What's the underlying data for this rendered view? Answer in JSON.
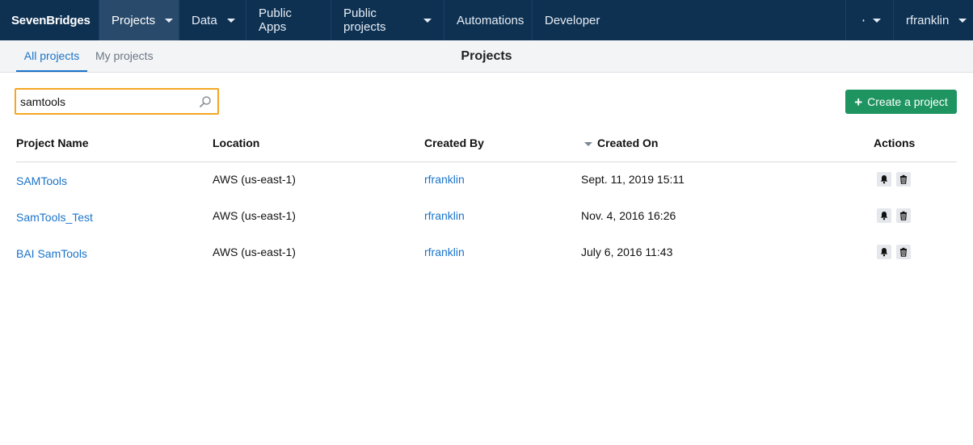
{
  "brand": "SevenBridges",
  "nav": {
    "items": [
      {
        "label": "Projects"
      },
      {
        "label": "Data"
      },
      {
        "label": "Public Apps"
      },
      {
        "label": "Public projects"
      },
      {
        "label": "Automations"
      },
      {
        "label": "Developer"
      }
    ],
    "user": "rfranklin"
  },
  "subnav": {
    "tabs": [
      {
        "label": "All projects"
      },
      {
        "label": "My projects"
      }
    ],
    "title": "Projects"
  },
  "search": {
    "value": "samtools"
  },
  "create_button": "Create a project",
  "table": {
    "headers": {
      "name": "Project Name",
      "location": "Location",
      "created_by": "Created By",
      "created_on": "Created On",
      "actions": "Actions"
    },
    "rows": [
      {
        "name": "SAMTools",
        "location": "AWS (us-east-1)",
        "created_by": "rfranklin",
        "created_on": "Sept. 11, 2019 15:11"
      },
      {
        "name": "SamTools_Test",
        "location": "AWS (us-east-1)",
        "created_by": "rfranklin",
        "created_on": "Nov. 4, 2016 16:26"
      },
      {
        "name": "BAI SamTools",
        "location": "AWS (us-east-1)",
        "created_by": "rfranklin",
        "created_on": "July 6, 2016 11:43"
      }
    ]
  },
  "colors": {
    "navbar": "#0e3152",
    "accent": "#1a73c9",
    "create": "#1e9560",
    "search_border": "#f5a623"
  }
}
